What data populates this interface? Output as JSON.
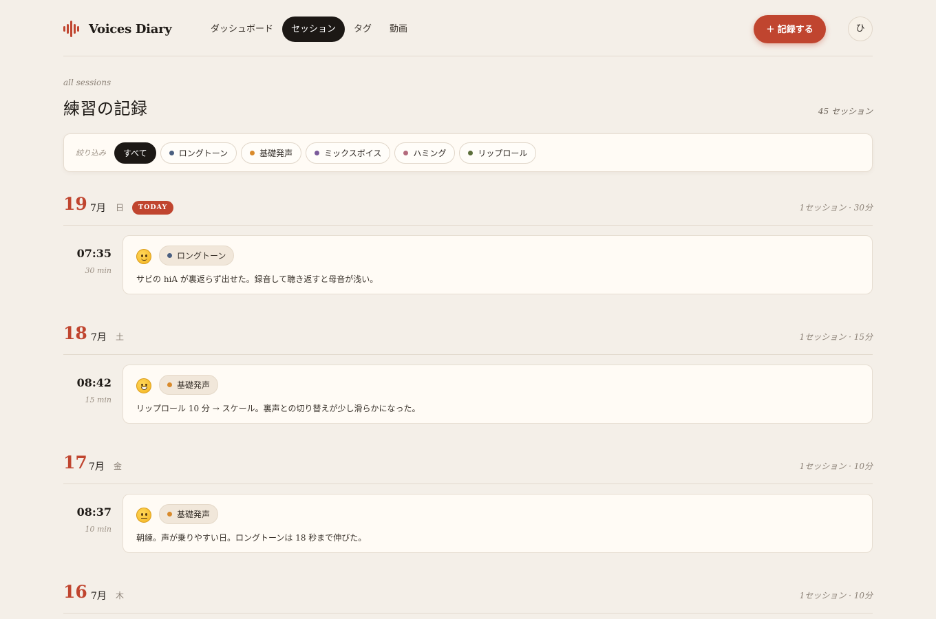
{
  "app": {
    "title": "Voices Diary"
  },
  "nav": [
    {
      "label": "ダッシュボード",
      "active": false
    },
    {
      "label": "セッション",
      "active": true
    },
    {
      "label": "タグ",
      "active": false
    },
    {
      "label": "動画",
      "active": false
    }
  ],
  "header": {
    "record_label": "記録する",
    "record_icon": "+",
    "avatar_initial": "ひ"
  },
  "page": {
    "eyebrow": "all sessions",
    "title": "練習の記録",
    "count": "45 セッション"
  },
  "filter": {
    "label": "絞り込み",
    "chips": [
      {
        "label": "すべて",
        "active": true
      },
      {
        "label": "ロングトーン",
        "color": "#4a5f80"
      },
      {
        "label": "基礎発声",
        "color": "#d98a2b"
      },
      {
        "label": "ミックスボイス",
        "color": "#7a5a9a"
      },
      {
        "label": "ハミング",
        "color": "#b36a7c"
      },
      {
        "label": "リップロール",
        "color": "#5b6e3a"
      }
    ]
  },
  "days": [
    {
      "day": "19",
      "month": "7月",
      "weekday": "日",
      "badge": "TODAY",
      "summary": "1セッション · 30分",
      "entry": {
        "time": "07:35",
        "duration": "30 min",
        "mood": "slight-smile",
        "tag": "ロングトーン",
        "tag_color": "#4a5f80",
        "note": "サビの hiA が裏返らず出せた。録音して聴き返すと母音が浅い。"
      }
    },
    {
      "day": "18",
      "month": "7月",
      "weekday": "土",
      "badge": "",
      "summary": "1セッション · 15分",
      "entry": {
        "time": "08:42",
        "duration": "15 min",
        "mood": "grin",
        "tag": "基礎発声",
        "tag_color": "#d98a2b",
        "note": "リップロール 10 分 → スケール。裏声との切り替えが少し滑らかになった。"
      }
    },
    {
      "day": "17",
      "month": "7月",
      "weekday": "金",
      "badge": "",
      "summary": "1セッション · 10分",
      "entry": {
        "time": "08:37",
        "duration": "10 min",
        "mood": "neutral",
        "tag": "基礎発声",
        "tag_color": "#d98a2b",
        "note": "朝練。声が乗りやすい日。ロングトーンは 18 秒まで伸びた。"
      }
    },
    {
      "day": "16",
      "month": "7月",
      "weekday": "木",
      "badge": "",
      "summary": "1セッション · 10分"
    }
  ]
}
